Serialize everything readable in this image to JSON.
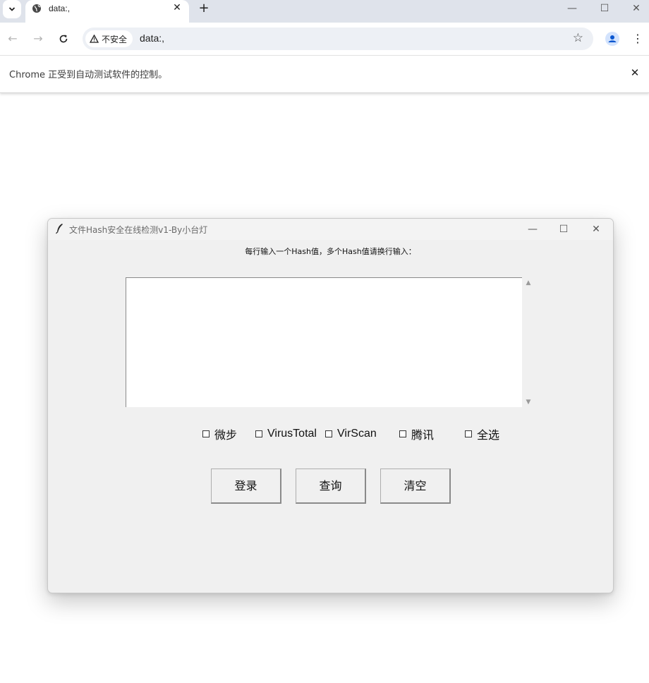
{
  "browser": {
    "tab_title": "data:,",
    "new_tab_label": "+",
    "url": "data:,",
    "security_label": "不安全",
    "infobar_text": "Chrome 正受到自动测试软件的控制。"
  },
  "app": {
    "window_title": "文件Hash安全在线检测v1-By小台灯",
    "instruction": "每行输入一个Hash值，多个Hash值请换行输入：",
    "checkboxes": [
      {
        "label": "微步",
        "checked": false
      },
      {
        "label": "VirusTotal",
        "checked": false
      },
      {
        "label": "VirScan",
        "checked": false
      },
      {
        "label": "腾讯",
        "checked": false
      },
      {
        "label": "全选",
        "checked": false
      }
    ],
    "buttons": {
      "login": "登录",
      "query": "查询",
      "clear": "清空"
    }
  },
  "icons": {
    "tab_menu": "chevron-down-icon",
    "favicon": "globe-icon",
    "close": "close-icon",
    "back": "back-arrow-icon",
    "forward": "forward-arrow-icon",
    "reload": "reload-icon",
    "warning": "warning-triangle-icon",
    "bookmark": "star-icon",
    "profile": "profile-icon",
    "menu": "kebab-menu-icon",
    "app": "feather-icon"
  }
}
